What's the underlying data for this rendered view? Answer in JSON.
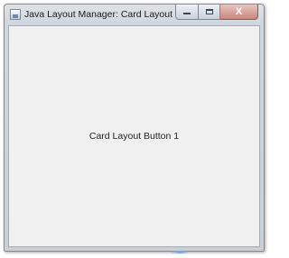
{
  "window": {
    "title": "Java Layout Manager: Card Layout",
    "controls": {
      "minimize_icon": "minimize-icon",
      "maximize_icon": "maximize-icon",
      "close_icon": "close-icon",
      "close_glyph": "X"
    }
  },
  "card_panel": {
    "button_label": "Card Layout Button 1"
  },
  "colors": {
    "client_background": "#f0f0f0",
    "titlebar": "#cfd6de",
    "close_button": "#c9877c"
  }
}
